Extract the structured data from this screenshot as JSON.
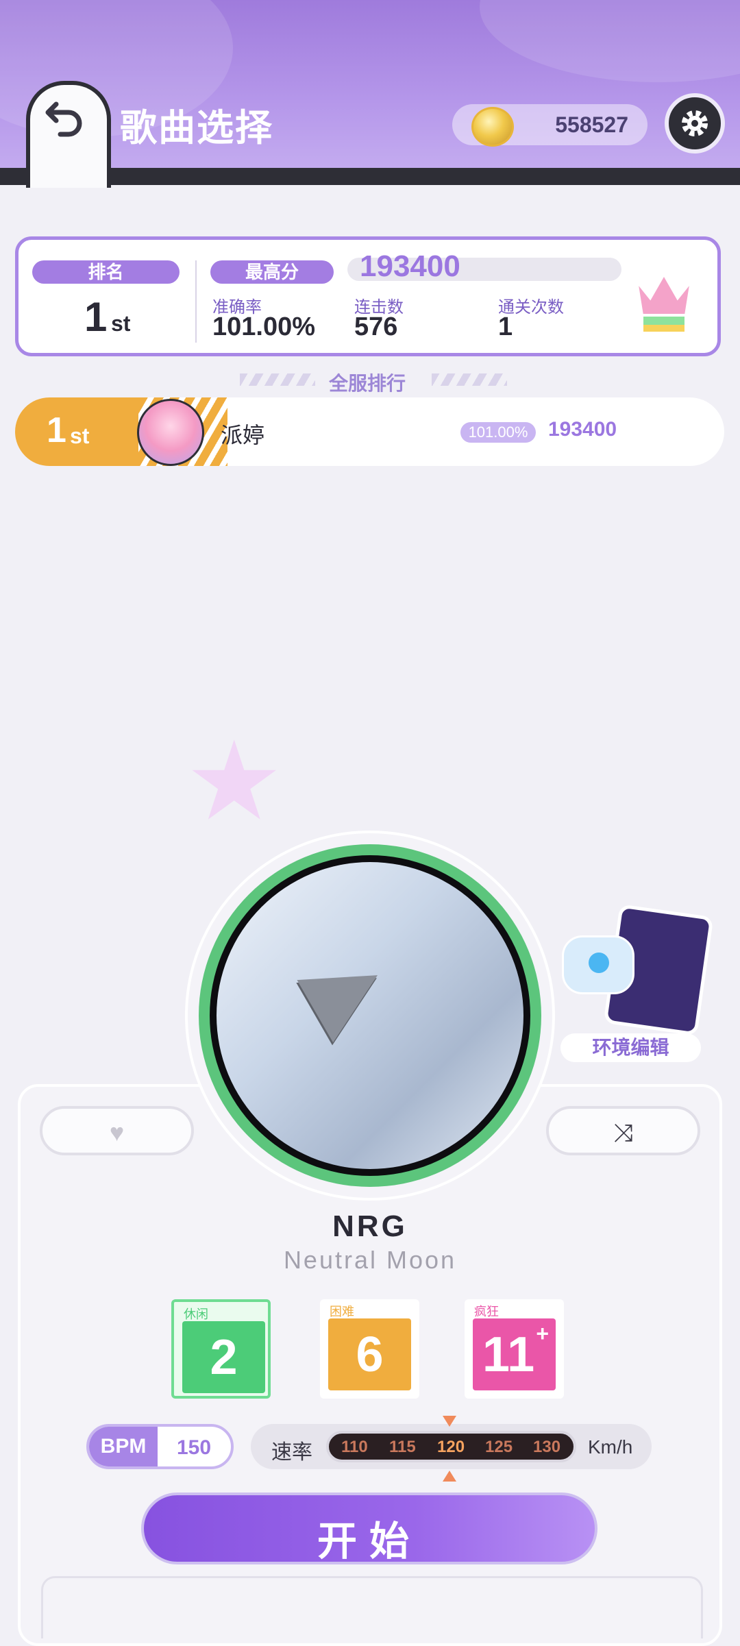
{
  "header": {
    "title": "歌曲选择",
    "coins": "558527"
  },
  "score_panel": {
    "rank_label": "排名",
    "rank_num": "1",
    "rank_suffix": "st",
    "high_score_label": "最高分",
    "high_score": "193400",
    "accuracy_label": "准确率",
    "accuracy": "101.00%",
    "combo_label": "连击数",
    "combo": "576",
    "clears_label": "通关次数",
    "clears": "1"
  },
  "leaderboard": {
    "title": "全服排行",
    "entries": [
      {
        "rank": "1",
        "suffix": "st",
        "name": "派婷",
        "accuracy": "101.00%",
        "score": "193400"
      }
    ]
  },
  "environment": {
    "label": "环境编辑"
  },
  "song": {
    "title": "NRG",
    "artist": "Neutral Moon"
  },
  "difficulties": [
    {
      "name": "休闲",
      "level": "2",
      "color": "#4ccc78",
      "selected": true
    },
    {
      "name": "困难",
      "level": "6",
      "color": "#f0ad3e",
      "selected": false
    },
    {
      "name": "疯狂",
      "level": "11",
      "plus": "+",
      "color": "#ea56a8",
      "selected": false
    }
  ],
  "bpm": {
    "label": "BPM",
    "value": "150"
  },
  "speed": {
    "label": "速率",
    "options": [
      "110",
      "115",
      "120",
      "125",
      "130"
    ],
    "selected": "120",
    "unit": "Km/h"
  },
  "start_label": "开始",
  "colors": {
    "accent": "#a37de2",
    "header": "#b597ea",
    "gold": "#f0ad3e"
  }
}
